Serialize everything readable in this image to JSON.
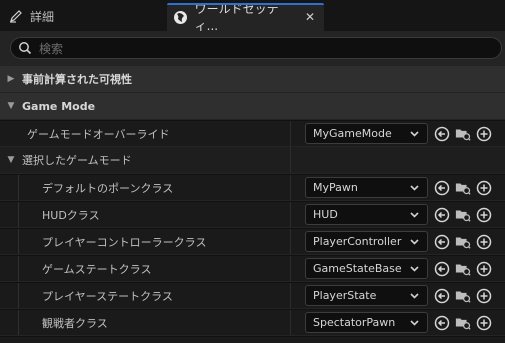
{
  "tabs": {
    "details_label": "詳細",
    "world_settings_label": "ワールドセッティ...",
    "close_glyph": "✕"
  },
  "search": {
    "placeholder": "検索"
  },
  "sections": {
    "precomputed_visibility": "事前計算された可視性",
    "game_mode": "Game Mode"
  },
  "game_mode": {
    "override_label": "ゲームモードオーバーライド",
    "override_value": "MyGameMode",
    "selected_header": "選択したゲームモード",
    "properties": [
      {
        "label": "デフォルトのポーンクラス",
        "value": "MyPawn"
      },
      {
        "label": "HUDクラス",
        "value": "HUD"
      },
      {
        "label": "プレイヤーコントローラークラス",
        "value": "PlayerController"
      },
      {
        "label": "ゲームステートクラス",
        "value": "GameStateBase"
      },
      {
        "label": "プレイヤーステートクラス",
        "value": "PlayerState"
      },
      {
        "label": "観戦者クラス",
        "value": "SpectatorPawn"
      }
    ]
  },
  "colors": {
    "accent": "#2f6fd6",
    "panel_bg": "#242424",
    "row_bg": "#1a1a1a",
    "section_bg": "#2f2f2f"
  }
}
